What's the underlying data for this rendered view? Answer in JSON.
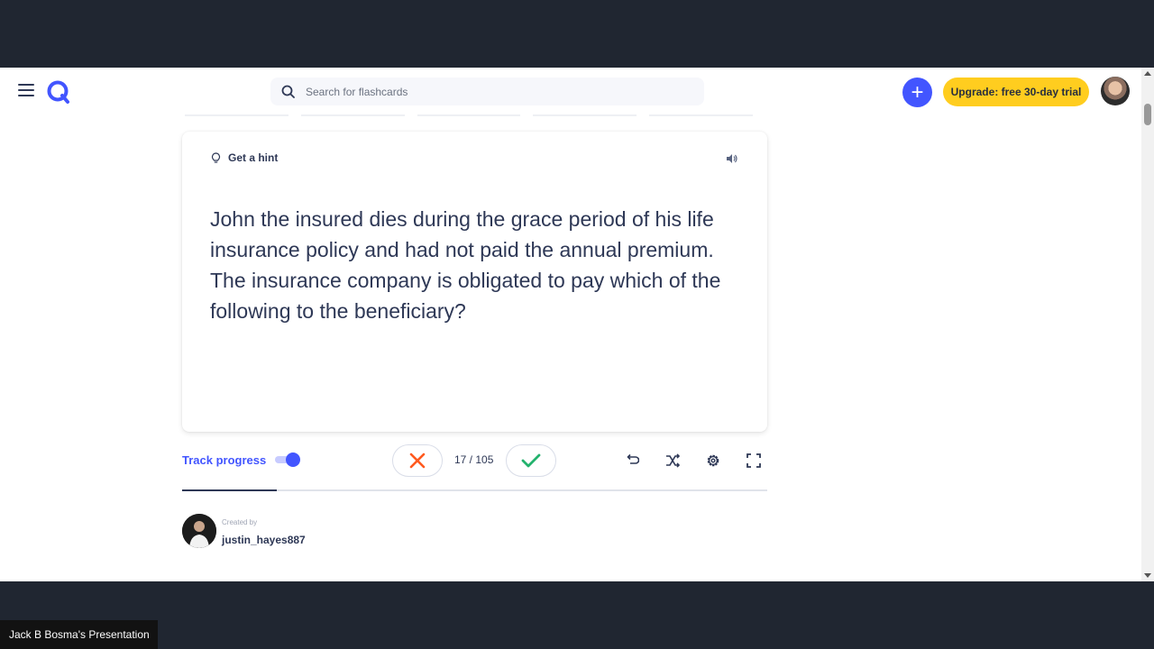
{
  "search": {
    "placeholder": "Search for flashcards"
  },
  "header": {
    "upgrade_label": "Upgrade: free 30-day trial",
    "create_label": "+"
  },
  "card": {
    "hint_label": "Get a hint",
    "question": "John the insured dies during the grace period of his life insurance policy and had not paid the annual premium. The insurance company is obligated to pay which of the following to the beneficiary?"
  },
  "controls": {
    "track_progress_label": "Track progress",
    "track_progress_on": true,
    "counter": "17 / 105",
    "current": 17,
    "total": 105
  },
  "creator": {
    "created_by_label": "Created by",
    "username": "justin_hayes887"
  },
  "presenter_label": "Jack B Bosma's Presentation",
  "colors": {
    "brand": "#4255ff",
    "upgrade": "#ffcd1f",
    "wrong": "#ff5a1f",
    "correct": "#23b26d",
    "text": "#2e3856"
  },
  "icons": [
    "menu-icon",
    "logo-icon",
    "search-icon",
    "plus-icon",
    "avatar",
    "lightbulb-icon",
    "speaker-icon",
    "close-icon",
    "check-icon",
    "undo-icon",
    "shuffle-icon",
    "gear-icon",
    "fullscreen-icon"
  ]
}
